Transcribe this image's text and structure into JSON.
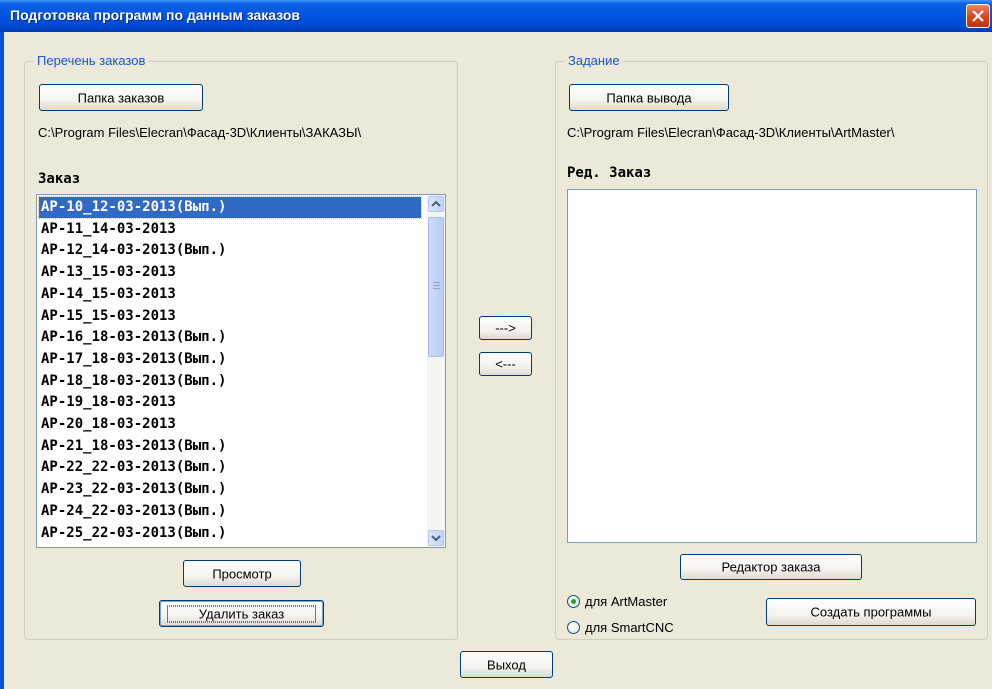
{
  "window": {
    "title": "Подготовка программ по данным заказов"
  },
  "orders_group": {
    "legend": "Перечень заказов",
    "folder_button": "Папка заказов",
    "folder_path": "C:\\Program Files\\Elecran\\Фасад-3D\\Клиенты\\ЗАКАЗЫ\\",
    "list_header": "Заказ",
    "items": [
      "AP-10_12-03-2013(Вып.)",
      "AP-11_14-03-2013",
      "AP-12_14-03-2013(Вып.)",
      "AP-13_15-03-2013",
      "AP-14_15-03-2013",
      "AP-15_15-03-2013",
      "AP-16_18-03-2013(Вып.)",
      "AP-17_18-03-2013(Вып.)",
      "AP-18_18-03-2013(Вып.)",
      "AP-19_18-03-2013",
      "AP-20_18-03-2013",
      "AP-21_18-03-2013(Вып.)",
      "AP-22_22-03-2013(Вып.)",
      "AP-23_22-03-2013(Вып.)",
      "AP-24_22-03-2013(Вып.)",
      "AP-25_22-03-2013(Вып.)"
    ],
    "selected_index": 0,
    "view_button": "Просмотр",
    "delete_button": "Удалить заказ"
  },
  "transfer": {
    "forward_label": "--->",
    "back_label": "<---"
  },
  "task_group": {
    "legend": "Задание",
    "output_button": "Папка вывода",
    "output_path": "C:\\Program Files\\Elecran\\Фасад-3D\\Клиенты\\ArtMaster\\",
    "list_header": "Ред. Заказ",
    "editor_button": "Редактор заказа",
    "radio_options": [
      "для ArtMaster",
      "для SmartCNC"
    ],
    "radio_selected": 0,
    "create_button": "Создать программы"
  },
  "exit_button": "Выход",
  "colors": {
    "title_bar": "#0054e3",
    "selection": "#316ac5",
    "legend": "#1a55d6",
    "dialog_bg": "#ece9d8"
  }
}
